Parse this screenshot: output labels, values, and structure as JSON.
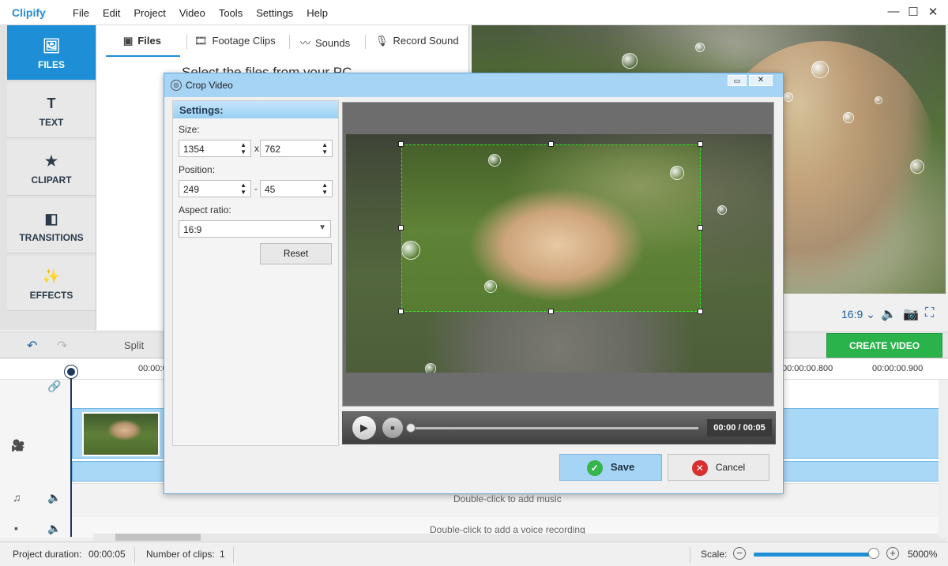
{
  "app": {
    "logo": "Clipify"
  },
  "menu": [
    "File",
    "Edit",
    "Project",
    "Video",
    "Tools",
    "Settings",
    "Help"
  ],
  "window": {
    "min": "—",
    "max": "☐",
    "close": "✕"
  },
  "categories": [
    {
      "label": "FILES",
      "icon": "🖼"
    },
    {
      "label": "TEXT",
      "icon": "T"
    },
    {
      "label": "CLIPART",
      "icon": "★"
    },
    {
      "label": "TRANSITIONS",
      "icon": "◧"
    },
    {
      "label": "EFFECTS",
      "icon": "✨"
    }
  ],
  "library": {
    "tabs": [
      {
        "label": "Files",
        "icon": "▣"
      },
      {
        "label": "Footage Clips",
        "icon": "🎞"
      },
      {
        "label": "Sounds",
        "icon": "〰"
      },
      {
        "label": "Record Sound",
        "icon": "🎙"
      }
    ],
    "hint": "Select the files from your PC"
  },
  "preview": {
    "aspect": "16:9 ⌄",
    "volume_icon": "🔈",
    "camera_icon": "📷",
    "fullscreen_icon": "⛶"
  },
  "toolbar": {
    "undo": "↶",
    "redo": "↷",
    "split": "Split",
    "create_video": "CREATE VIDEO"
  },
  "timeline": {
    "ruler_labels": [
      "00:00:0",
      "00:00:00.800",
      "00:00:00.900"
    ],
    "music_hint": "Double-click to add music",
    "voice_hint": "Double-click to add a voice recording"
  },
  "status": {
    "duration_label": "Project duration:",
    "duration_value": "00:00:05",
    "clips_label": "Number of clips:",
    "clips_value": "1",
    "scale_label": "Scale:",
    "scale_value": "5000%",
    "zoom_level": 0.97
  },
  "crop_dialog": {
    "title": "Crop Video",
    "settings_header": "Settings:",
    "size_label": "Size:",
    "size_w": "1354",
    "size_sep": "x",
    "size_h": "762",
    "position_label": "Position:",
    "pos_x": "249",
    "pos_sep": "-",
    "pos_y": "45",
    "aspect_label": "Aspect ratio:",
    "aspect_value": "16:9",
    "reset": "Reset",
    "time": "00:00 / 00:05",
    "save": "Save",
    "cancel": "Cancel"
  }
}
